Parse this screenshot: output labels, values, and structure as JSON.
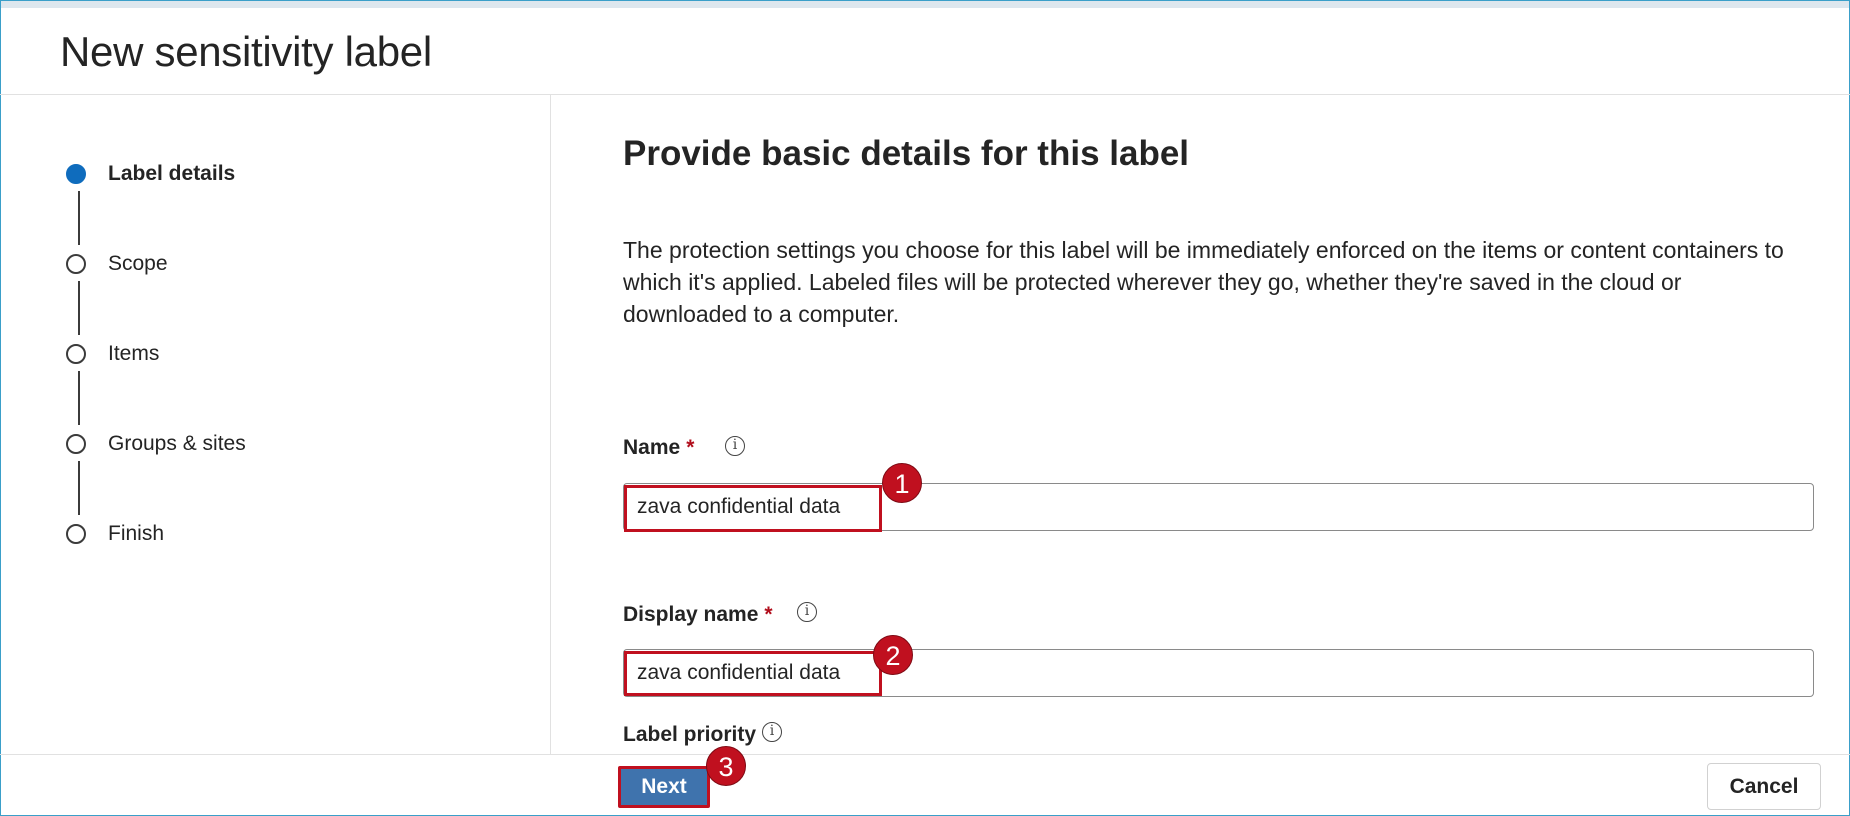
{
  "header": {
    "title": "New sensitivity label"
  },
  "stepper": {
    "steps": [
      {
        "label": "Label details",
        "active": true
      },
      {
        "label": "Scope",
        "active": false
      },
      {
        "label": "Items",
        "active": false
      },
      {
        "label": "Groups & sites",
        "active": false
      },
      {
        "label": "Finish",
        "active": false
      }
    ]
  },
  "main": {
    "heading": "Provide basic details for this label",
    "description": "The protection settings you choose for this label will be immediately enforced on the items or content containers to which it's applied. Labeled files will be protected wherever they go, whether they're saved in the cloud or downloaded to a computer.",
    "name_field": {
      "label": "Name",
      "required_mark": "*",
      "value": "zava confidential data",
      "info_icon": "info-icon"
    },
    "display_name_field": {
      "label": "Display name",
      "required_mark": "*",
      "value": "zava confidential data",
      "info_icon": "info-icon"
    },
    "label_priority": {
      "label": "Label priority",
      "info_icon": "info-icon"
    }
  },
  "annotations": {
    "badges": [
      "1",
      "2",
      "3"
    ],
    "color": "#c0101f"
  },
  "footer": {
    "next_label": "Next",
    "cancel_label": "Cancel"
  },
  "colors": {
    "accent": "#0f6cbd",
    "primary_button": "#3f73ad",
    "annotation": "#c0101f"
  }
}
